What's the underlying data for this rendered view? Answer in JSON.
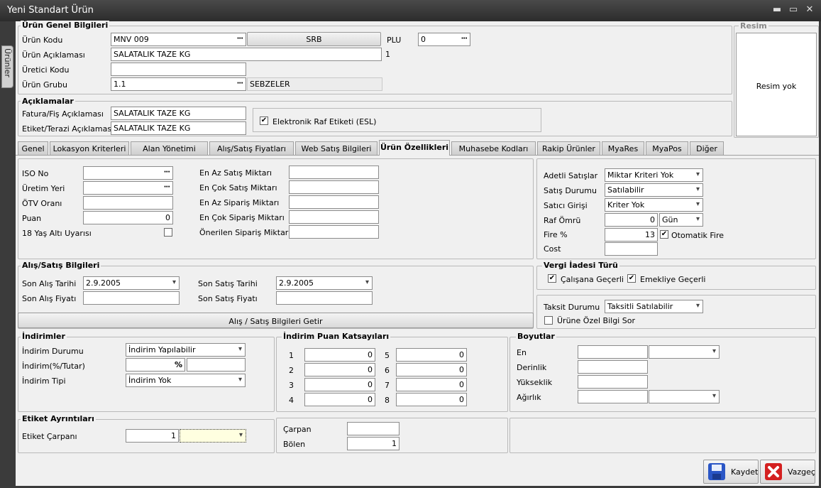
{
  "window": {
    "title": "Yeni Standart Ürün",
    "sidebar_tab": "Ürünler"
  },
  "general": {
    "section_title": "Ürün Genel Bilgileri",
    "code_label": "Ürün Kodu",
    "code_value": "MNV 009",
    "srb_label": "SRB",
    "plu_label": "PLU",
    "plu_value": "0",
    "desc_label": "Ürün Açıklaması",
    "desc_value": "SALATALIK TAZE KG",
    "desc_suffix": "1",
    "maker_label": "Üretici Kodu",
    "maker_value": "",
    "group_label": "Ürün Grubu",
    "group_value": "1.1",
    "group_name": "SEBZELER"
  },
  "image": {
    "section_title": "Resim",
    "empty_text": "Resim yok"
  },
  "notes": {
    "section_title": "Açıklamalar",
    "invoice_label": "Fatura/Fiş Açıklaması",
    "invoice_value": "SALATALIK TAZE KG",
    "scale_label": "Etiket/Terazi Açıklaması",
    "scale_value": "SALATALIK TAZE KG",
    "esl_label": "Elektronik Raf Etiketi (ESL)",
    "esl_checked": true
  },
  "tabs": [
    "Genel",
    "Lokasyon Kriterleri",
    "Alan Yönetimi",
    "Alış/Satış Fiyatları",
    "Web Satış Bilgileri",
    "Ürün Özellikleri",
    "Muhasebe Kodları",
    "Rakip Ürünler",
    "MyaRes",
    "MyaPos",
    "Diğer"
  ],
  "active_tab": "Ürün Özellikleri",
  "props": {
    "iso_label": "ISO No",
    "iso_value": "",
    "origin_label": "Üretim Yeri",
    "origin_value": "",
    "otv_label": "ÖTV Oranı",
    "otv_value": "",
    "points_label": "Puan",
    "points_value": "0",
    "age_label": "18 Yaş Altı Uyarısı",
    "min_sale_label": "En Az Satış Miktarı",
    "max_sale_label": "En Çok Satış Miktarı",
    "min_order_label": "En Az Sipariş Miktarı",
    "max_order_label": "En Çok Sipariş Miktarı",
    "rec_order_label": "Önerilen Sipariş Miktarı"
  },
  "sales_opts": {
    "unit_label": "Adetli Satışlar",
    "unit_value": "Miktar Kriteri Yok",
    "status_label": "Satış Durumu",
    "status_value": "Satılabilir",
    "entry_label": "Satıcı Girişi",
    "entry_value": "Kriter Yok",
    "shelf_label": "Raf Ömrü",
    "shelf_value": "0",
    "shelf_unit": "Gün",
    "fire_label": "Fire %",
    "fire_value": "13",
    "auto_fire_label": "Otomatik Fire",
    "auto_fire_checked": true,
    "cost_label": "Cost",
    "cost_value": ""
  },
  "buysell": {
    "section_title": "Alış/Satış Bilgileri",
    "last_buy_date_label": "Son Alış Tarihi",
    "last_buy_date": "2.9.2005",
    "last_sale_date_label": "Son Satış Tarihi",
    "last_sale_date": "2.9.2005",
    "last_buy_price_label": "Son Alış Fiyatı",
    "last_buy_price": "",
    "last_sale_price_label": "Son Satış Fiyatı",
    "last_sale_price": "",
    "fetch_button": "Alış / Satış Bilgileri Getir"
  },
  "tax": {
    "section_title": "Vergi İadesi Türü",
    "worker_label": "Çalışana Geçerli",
    "worker_checked": true,
    "retired_label": "Emekliye Geçerli",
    "retired_checked": true
  },
  "installment": {
    "label": "Taksit Durumu",
    "value": "Taksitli Satılabilir",
    "special_label": "Ürüne Özel Bilgi Sor",
    "special_checked": false
  },
  "discounts": {
    "section_title": "İndirimler",
    "status_label": "İndirim Durumu",
    "status_value": "İndirim Yapılabilir",
    "rate_label": "İndirim(%/Tutar)",
    "rate_symbol": "%",
    "rate_value": "",
    "type_label": "İndirim Tipi",
    "type_value": "İndirim Yok"
  },
  "points_coef": {
    "section_title": "İndirim Puan Katsayıları",
    "rows": [
      {
        "n": "1",
        "v": "0"
      },
      {
        "n": "2",
        "v": "0"
      },
      {
        "n": "3",
        "v": "0"
      },
      {
        "n": "4",
        "v": "0"
      },
      {
        "n": "5",
        "v": "0"
      },
      {
        "n": "6",
        "v": "0"
      },
      {
        "n": "7",
        "v": "0"
      },
      {
        "n": "8",
        "v": "0"
      }
    ]
  },
  "dims": {
    "section_title": "Boyutlar",
    "width_label": "En",
    "depth_label": "Derinlik",
    "height_label": "Yükseklik",
    "weight_label": "Ağırlık"
  },
  "label_details": {
    "section_title": "Etiket Ayrıntıları",
    "multiplier_label": "Etiket Çarpanı",
    "multiplier_value": "1",
    "mult_label": "Çarpan",
    "mult_value": "",
    "div_label": "Bölen",
    "div_value": "1"
  },
  "actions": {
    "save": "Kaydet",
    "cancel": "Vazgeç"
  },
  "colors": {
    "title_bar": "#2c2c2c",
    "panel": "#f0f0f0",
    "save_icon": "#2a56c6",
    "cancel_icon": "#d42020"
  }
}
